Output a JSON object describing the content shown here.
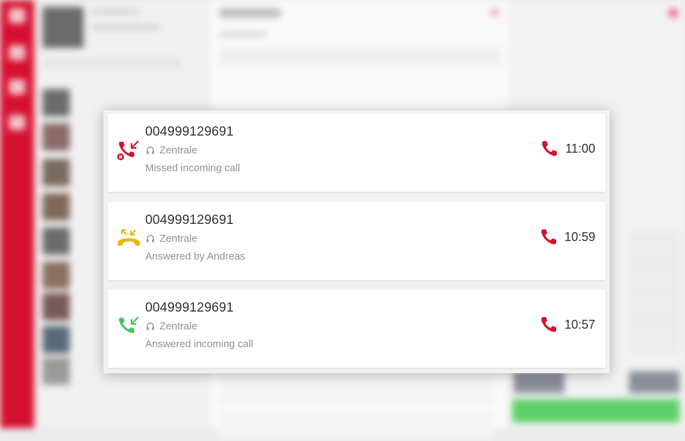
{
  "colors": {
    "accent_red": "#d51030",
    "missed": "#d51030",
    "forwarded": "#f0b400",
    "answered": "#46c45a",
    "text_primary": "#2f2f2f",
    "text_secondary": "#8f8f8f"
  },
  "calls": [
    {
      "number": "004999129691",
      "line_name": "Zentrale",
      "description": "Missed incoming call",
      "time": "11:00",
      "status_icon": "missed-incoming-call-icon",
      "line_icon": "headset-icon",
      "action_icon": "phone-icon"
    },
    {
      "number": "004999129691",
      "line_name": "Zentrale",
      "description": "Answered by Andreas",
      "time": "10:59",
      "status_icon": "answered-elsewhere-call-icon",
      "line_icon": "headset-icon",
      "action_icon": "phone-icon"
    },
    {
      "number": "004999129691",
      "line_name": "Zentrale",
      "description": "Answered incoming call",
      "time": "10:57",
      "status_icon": "answered-incoming-call-icon",
      "line_icon": "headset-icon",
      "action_icon": "phone-icon"
    }
  ]
}
